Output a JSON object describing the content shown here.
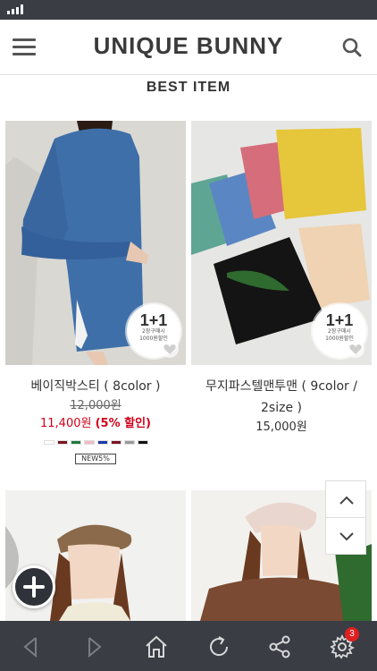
{
  "header": {
    "brand": "UNIQUE BUNNY",
    "menu_icon": "hamburger-menu-icon",
    "search_icon": "search-icon"
  },
  "section": {
    "title": "BEST ITEM"
  },
  "products": [
    {
      "name": "베이직박스티 ( 8color )",
      "original_price": "12,000원",
      "sale_price": "11,400원",
      "discount": "(5% 할인)",
      "badge": {
        "main": "1+1",
        "line1": "2장구매시",
        "line2": "1000원할인"
      },
      "colors": [
        "#ffffff",
        "#7a1420",
        "#1e7a3a",
        "#f2b8c6",
        "#1a3aa8",
        "#7a1420",
        "#9a9a9a",
        "#111111"
      ],
      "tag": "NEW5%"
    },
    {
      "name": "무지파스텔맨투맨 ( 9color / 2size )",
      "price": "15,000원",
      "badge": {
        "main": "1+1",
        "line1": "2장구매시",
        "line2": "1000원할인"
      }
    }
  ],
  "bottom_nav": {
    "back_icon": "back-arrow-icon",
    "forward_icon": "forward-arrow-icon",
    "home_icon": "home-icon",
    "refresh_icon": "refresh-icon",
    "share_icon": "share-icon",
    "settings_icon": "gear-icon",
    "settings_badge": "3"
  },
  "colors": {
    "status_bar": "#3a3d44",
    "sale_red": "#d0021b",
    "notification_red": "#e02020"
  }
}
